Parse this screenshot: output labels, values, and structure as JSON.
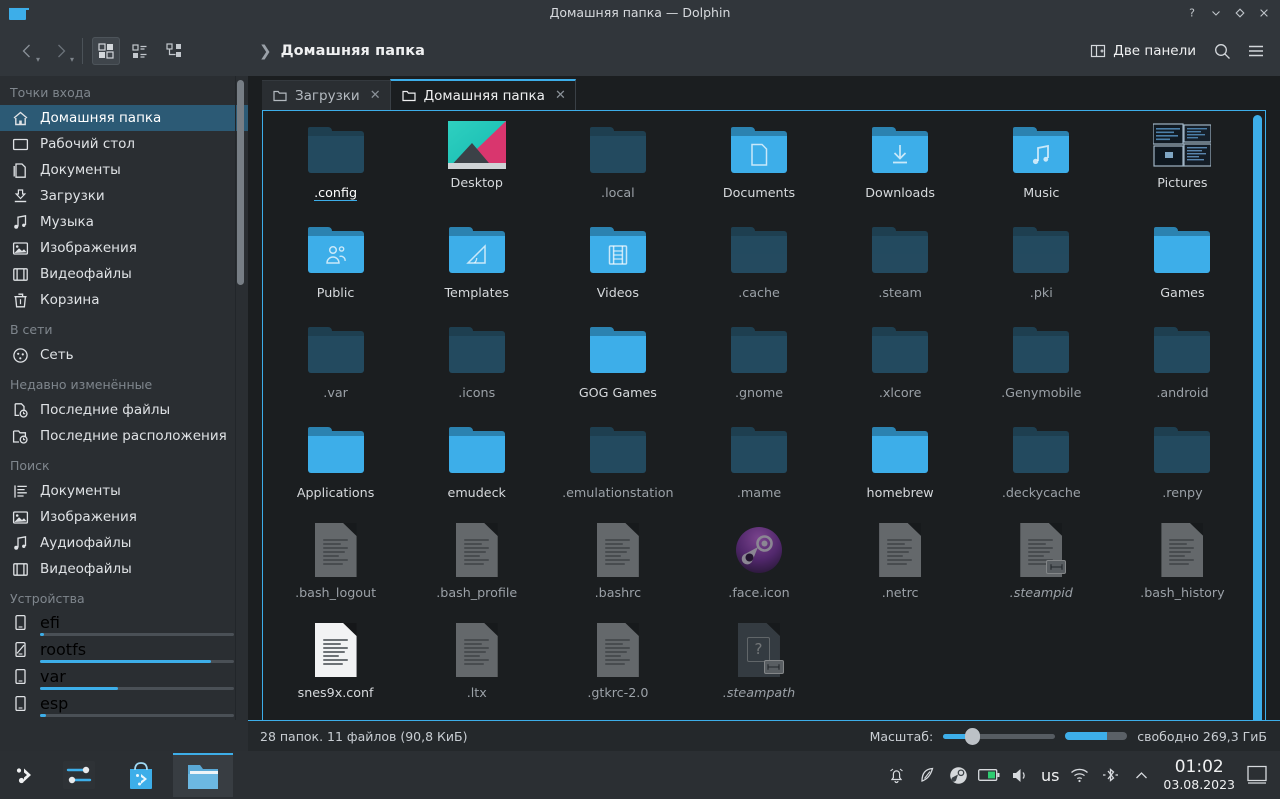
{
  "window": {
    "title": "Домашняя папка — Dolphin",
    "app_icon": "folder-icon",
    "buttons": [
      {
        "name": "help-button",
        "glyph": "?"
      },
      {
        "name": "minimize-button",
        "glyph": "v"
      },
      {
        "name": "maximize-button",
        "glyph": "diamond"
      },
      {
        "name": "close-button",
        "glyph": "x"
      }
    ]
  },
  "toolbar": {
    "back_label": "Назад",
    "forward_label": "Вперёд",
    "view_icons_label": "Значки",
    "view_compact_label": "Список",
    "view_details_label": "Таблица",
    "breadcrumb": "Домашняя папка",
    "split_label": "Две панели",
    "search_label": "Найти",
    "menu_label": "Меню"
  },
  "tabs": [
    {
      "label": "Загрузки",
      "active": false,
      "close": "✕"
    },
    {
      "label": "Домашняя папка",
      "active": true,
      "close": "✕"
    }
  ],
  "sidebar": {
    "groups": [
      {
        "title": "Точки входа",
        "items": [
          {
            "label": "Домашняя папка",
            "icon": "home-icon",
            "selected": true
          },
          {
            "label": "Рабочий стол",
            "icon": "desktop-icon",
            "selected": false
          },
          {
            "label": "Документы",
            "icon": "document-icon",
            "selected": false
          },
          {
            "label": "Загрузки",
            "icon": "download-icon",
            "selected": false
          },
          {
            "label": "Музыка",
            "icon": "music-icon",
            "selected": false
          },
          {
            "label": "Изображения",
            "icon": "image-icon",
            "selected": false
          },
          {
            "label": "Видеофайлы",
            "icon": "video-icon",
            "selected": false
          },
          {
            "label": "Корзина",
            "icon": "trash-icon",
            "selected": false
          }
        ]
      },
      {
        "title": "В сети",
        "items": [
          {
            "label": "Сеть",
            "icon": "network-icon",
            "selected": false
          }
        ]
      },
      {
        "title": "Недавно изменённые",
        "items": [
          {
            "label": "Последние файлы",
            "icon": "recent-file-icon",
            "selected": false
          },
          {
            "label": "Последние расположения",
            "icon": "recent-folder-icon",
            "selected": false
          }
        ]
      },
      {
        "title": "Поиск",
        "items": [
          {
            "label": "Документы",
            "icon": "search-document-icon",
            "selected": false
          },
          {
            "label": "Изображения",
            "icon": "image-icon",
            "selected": false
          },
          {
            "label": "Аудиофайлы",
            "icon": "music-icon",
            "selected": false
          },
          {
            "label": "Видеофайлы",
            "icon": "video-icon",
            "selected": false
          }
        ]
      }
    ],
    "devices_title": "Устройства",
    "devices": [
      {
        "label": "efi",
        "icon": "drive-icon",
        "usage_percent": 2
      },
      {
        "label": "rootfs",
        "icon": "root-drive-icon",
        "usage_percent": 88
      },
      {
        "label": "var",
        "icon": "drive-icon",
        "usage_percent": 40
      },
      {
        "label": "esp",
        "icon": "drive-icon",
        "usage_percent": 3
      }
    ]
  },
  "files": [
    {
      "name": ".config",
      "type": "folder",
      "hidden": true,
      "hover": true
    },
    {
      "name": "Desktop",
      "type": "thumb-wallpaper",
      "hidden": false
    },
    {
      "name": ".local",
      "type": "folder",
      "hidden": true
    },
    {
      "name": "Documents",
      "type": "folder",
      "hidden": false,
      "emblem": "document-emblem"
    },
    {
      "name": "Downloads",
      "type": "folder",
      "hidden": false,
      "emblem": "download-emblem"
    },
    {
      "name": "Music",
      "type": "folder",
      "hidden": false,
      "emblem": "music-emblem"
    },
    {
      "name": "Pictures",
      "type": "thumb-photos",
      "hidden": false
    },
    {
      "name": "Public",
      "type": "folder",
      "hidden": false,
      "emblem": "people-emblem"
    },
    {
      "name": "Templates",
      "type": "folder",
      "hidden": false,
      "emblem": "ruler-emblem"
    },
    {
      "name": "Videos",
      "type": "folder",
      "hidden": false,
      "emblem": "film-emblem"
    },
    {
      "name": ".cache",
      "type": "folder",
      "hidden": true
    },
    {
      "name": ".steam",
      "type": "folder",
      "hidden": true
    },
    {
      "name": ".pki",
      "type": "folder",
      "hidden": true
    },
    {
      "name": "Games",
      "type": "folder",
      "hidden": false
    },
    {
      "name": ".var",
      "type": "folder",
      "hidden": true
    },
    {
      "name": ".icons",
      "type": "folder",
      "hidden": true
    },
    {
      "name": "GOG Games",
      "type": "folder",
      "hidden": false
    },
    {
      "name": ".gnome",
      "type": "folder",
      "hidden": true
    },
    {
      "name": ".xlcore",
      "type": "folder",
      "hidden": true
    },
    {
      "name": ".Genymobile",
      "type": "folder",
      "hidden": true
    },
    {
      "name": ".android",
      "type": "folder",
      "hidden": true
    },
    {
      "name": "Applications",
      "type": "folder",
      "hidden": false
    },
    {
      "name": "emudeck",
      "type": "folder",
      "hidden": false
    },
    {
      "name": ".emulationstation",
      "type": "folder",
      "hidden": true
    },
    {
      "name": ".mame",
      "type": "folder",
      "hidden": true
    },
    {
      "name": "homebrew",
      "type": "folder",
      "hidden": false
    },
    {
      "name": ".deckycache",
      "type": "folder",
      "hidden": true
    },
    {
      "name": ".renpy",
      "type": "folder",
      "hidden": true
    },
    {
      "name": ".bash_logout",
      "type": "file",
      "hidden": true
    },
    {
      "name": ".bash_profile",
      "type": "file",
      "hidden": true
    },
    {
      "name": ".bashrc",
      "type": "file",
      "hidden": true
    },
    {
      "name": ".face.icon",
      "type": "steam-icon",
      "hidden": true
    },
    {
      "name": ".netrc",
      "type": "file",
      "hidden": true
    },
    {
      "name": ".steampid",
      "type": "file",
      "hidden": true,
      "symlink": true
    },
    {
      "name": ".bash_history",
      "type": "file",
      "hidden": true
    },
    {
      "name": "snes9x.conf",
      "type": "file-white",
      "hidden": false
    },
    {
      "name": ".ltx",
      "type": "file",
      "hidden": true
    },
    {
      "name": ".gtkrc-2.0",
      "type": "file",
      "hidden": true
    },
    {
      "name": ".steampath",
      "type": "file-unknown",
      "hidden": true,
      "symlink": true
    }
  ],
  "status": {
    "summary": "28 папок. 11 файлов (90,8 КиБ)",
    "zoom_label": "Масштаб:",
    "free_space": "свободно 269,3 ГиБ",
    "zoom_percent": 22,
    "free_percent": 68
  },
  "taskbar": {
    "launcher_label": "Меню запуска приложений",
    "tasks": [
      {
        "name": "system-settings",
        "active": false
      },
      {
        "name": "discover",
        "active": false
      },
      {
        "name": "dolphin",
        "active": true
      }
    ],
    "tray": [
      {
        "name": "notifications-icon",
        "label": "Уведомления"
      },
      {
        "name": "kdeconnect-icon",
        "label": "KDE Connect"
      },
      {
        "name": "steam-icon",
        "label": "Steam"
      },
      {
        "name": "battery-icon",
        "label": "Батарея"
      },
      {
        "name": "volume-icon",
        "label": "Громкость"
      }
    ],
    "keyboard_layout": "us",
    "tray_after": [
      {
        "name": "wifi-icon",
        "label": "Сеть Wi-Fi"
      },
      {
        "name": "bluetooth-icon",
        "label": "Bluetooth"
      },
      {
        "name": "chevron-up-icon",
        "label": "Показать скрытые значки"
      }
    ],
    "clock_time": "01:02",
    "clock_date": "03.08.2023",
    "show_desktop_label": "Свернуть все окна"
  },
  "colors": {
    "accent": "#3daee9",
    "titlebar": "#31363b",
    "sidebar": "#2a2e32",
    "content": "#1b1e20",
    "selection": "#2c5a75"
  }
}
